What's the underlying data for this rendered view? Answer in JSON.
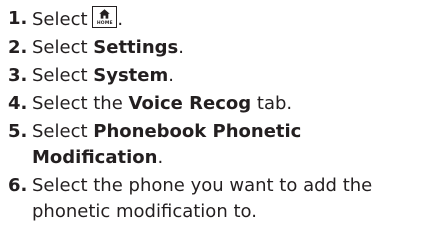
{
  "steps": [
    {
      "number": "1.",
      "prefix": "Select",
      "icon": "home-icon",
      "icon_label": "HOME",
      "suffix": "."
    },
    {
      "number": "2.",
      "prefix": "Select",
      "bold": "Settings",
      "suffix": "."
    },
    {
      "number": "3.",
      "prefix": "Select",
      "bold": "System",
      "suffix": "."
    },
    {
      "number": "4.",
      "prefix": "Select the",
      "bold": "Voice Recog",
      "suffix": "tab."
    },
    {
      "number": "5.",
      "prefix": "Select",
      "bold": "Phonebook Phonetic Modification",
      "suffix": "."
    },
    {
      "number": "6.",
      "text": "Select the phone you want to add the phonetic modification to."
    }
  ]
}
